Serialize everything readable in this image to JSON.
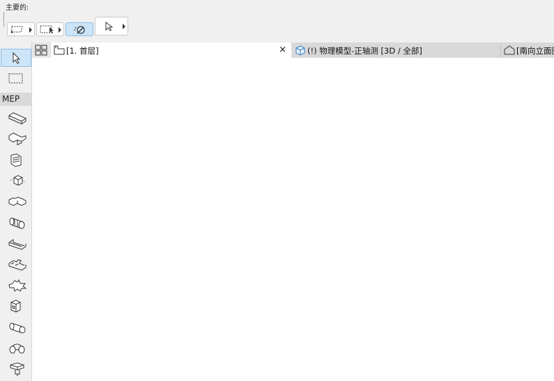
{
  "toolbar": {
    "label": "主要的:",
    "buttons": [
      {
        "icon": "marquee-polygon-icon",
        "has_menu": true
      },
      {
        "icon": "marquee-select-icon",
        "has_menu": true
      },
      {
        "icon": "magic-wand-icon",
        "active": true
      },
      {
        "icon": "arrow-pointer-icon",
        "has_menu": true
      }
    ]
  },
  "tabs": [
    {
      "icon": "floor-plan-icon",
      "label": "[1. 首层]",
      "active": true,
      "closable": true,
      "close_glyph": "×"
    },
    {
      "icon": "3d-box-icon",
      "label": "(!) 物理模型-正轴测 [3D / 全部]",
      "active": false
    },
    {
      "icon": "elevation-house-icon",
      "label": "[南向立面图]",
      "active": false
    }
  ],
  "toolbox": {
    "top_tools": [
      {
        "icon": "arrow-pointer-icon",
        "active": true
      },
      {
        "icon": "marquee-icon",
        "active": false
      }
    ],
    "section_label": "MEP",
    "mep_tools": [
      "duct-straight-icon",
      "duct-tee-icon",
      "duct-terminal-icon",
      "duct-equipment-icon",
      "duct-cross-icon",
      "pipe-straight-icon",
      "cable-tray-icon",
      "cable-tray-tee-icon",
      "cable-tray-cross-icon",
      "equipment-box-icon",
      "pipe-segment-icon",
      "pipe-elbow-icon",
      "pipe-valve-icon"
    ]
  },
  "colors": {
    "active_fill": "#cde5f8",
    "active_border": "#8dbfe8",
    "canvas": "#ffffff"
  }
}
